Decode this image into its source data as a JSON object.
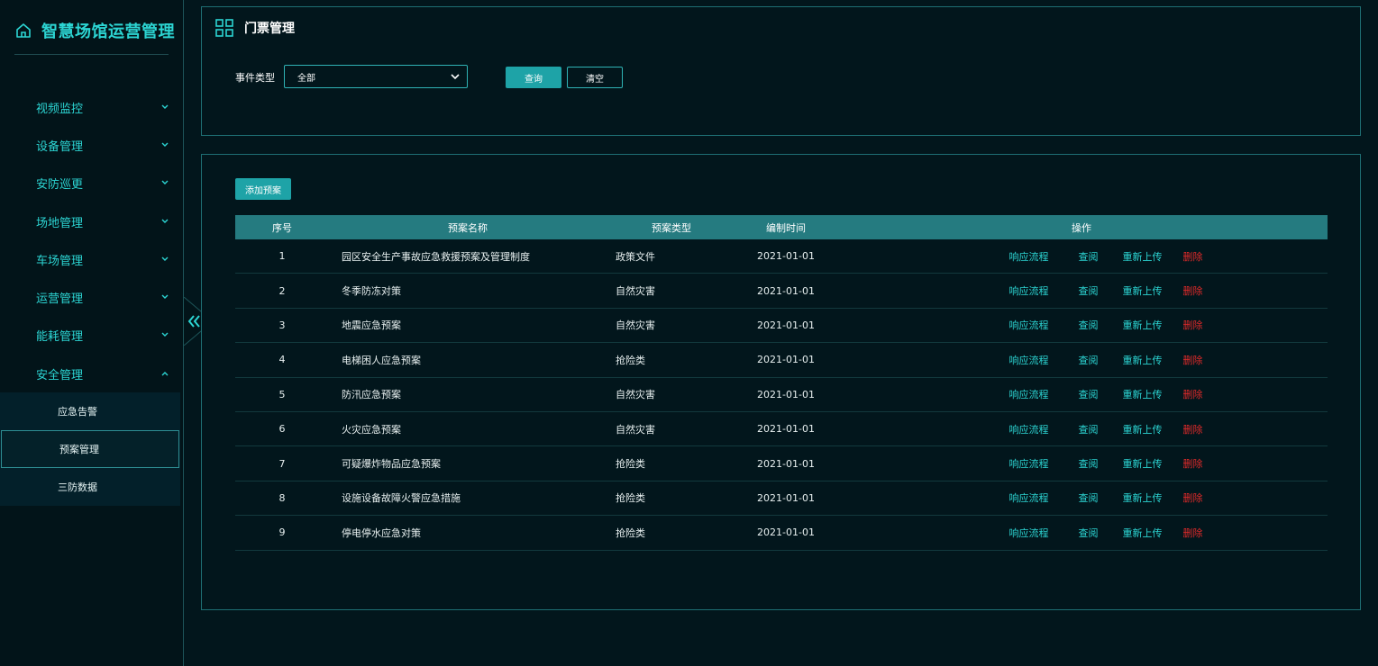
{
  "app": {
    "title": "智慧场馆运营管理"
  },
  "sidebar": {
    "items": [
      {
        "label": "视频监控",
        "expanded": false
      },
      {
        "label": "设备管理",
        "expanded": false
      },
      {
        "label": "安防巡更",
        "expanded": false
      },
      {
        "label": "场地管理",
        "expanded": false
      },
      {
        "label": "车场管理",
        "expanded": false
      },
      {
        "label": "运营管理",
        "expanded": false
      },
      {
        "label": "能耗管理",
        "expanded": false
      },
      {
        "label": "安全管理",
        "expanded": true
      }
    ],
    "subitems": [
      {
        "label": "应急告警",
        "active": false
      },
      {
        "label": "预案管理",
        "active": true
      },
      {
        "label": "三防数据",
        "active": false
      }
    ]
  },
  "filter_panel": {
    "title": "门票管理",
    "event_type_label": "事件类型",
    "event_type_value": "全部",
    "query_label": "查询",
    "clear_label": "清空"
  },
  "main": {
    "add_label": "添加预案",
    "columns": [
      "序号",
      "预案名称",
      "预案类型",
      "编制时间",
      "操作"
    ],
    "op_labels": {
      "flow": "响应流程",
      "view": "查阅",
      "reupload": "重新上传",
      "delete": "删除"
    },
    "rows": [
      {
        "idx": "1",
        "name": "园区安全生产事故应急救援预案及管理制度",
        "type": "政策文件",
        "time": "2021-01-01"
      },
      {
        "idx": "2",
        "name": "冬季防冻对策",
        "type": "自然灾害",
        "time": "2021-01-01"
      },
      {
        "idx": "3",
        "name": "地震应急预案",
        "type": "自然灾害",
        "time": "2021-01-01"
      },
      {
        "idx": "4",
        "name": "电梯困人应急预案",
        "type": "抢险类",
        "time": "2021-01-01"
      },
      {
        "idx": "5",
        "name": "防汛应急预案",
        "type": "自然灾害",
        "time": "2021-01-01"
      },
      {
        "idx": "6",
        "name": "火灾应急预案",
        "type": "自然灾害",
        "time": "2021-01-01"
      },
      {
        "idx": "7",
        "name": "可疑爆炸物品应急预案",
        "type": "抢险类",
        "time": "2021-01-01"
      },
      {
        "idx": "8",
        "name": "设施设备故障火警应急措施",
        "type": "抢险类",
        "time": "2021-01-01"
      },
      {
        "idx": "9",
        "name": "停电停水应急对策",
        "type": "抢险类",
        "time": "2021-01-01"
      }
    ]
  },
  "colors": {
    "accent": "#2cd5d3",
    "button": "#1ea3a7",
    "header": "#257b80",
    "background": "#02161c",
    "danger": "#e12a2a"
  }
}
